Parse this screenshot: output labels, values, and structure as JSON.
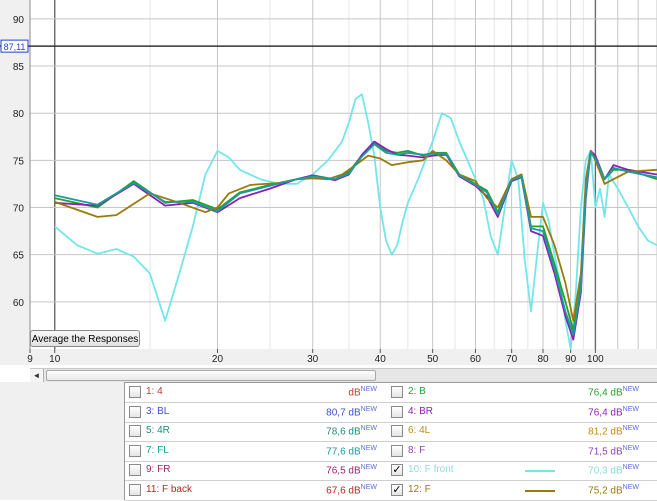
{
  "cursor_readout": "87,11",
  "average_button_label": "Average the Responses",
  "scroll_left_glyph": "◄",
  "chart_data": {
    "type": "line",
    "xlabel": "",
    "ylabel": "",
    "x_scale": "log",
    "xlim": [
      9,
      130
    ],
    "ylim": [
      55,
      92
    ],
    "x_ticks": [
      9,
      10,
      20,
      30,
      40,
      50,
      60,
      70,
      80,
      90,
      100
    ],
    "x_tick_labels": [
      "9",
      "10",
      "20",
      "30",
      "40",
      "50",
      "60",
      "70",
      "80",
      "90",
      "100"
    ],
    "y_ticks": [
      60,
      65,
      70,
      75,
      80,
      85,
      90
    ],
    "y_tick_labels": [
      "60",
      "65",
      "70",
      "75",
      "80",
      "85",
      "90"
    ],
    "cursor_y": 87.11,
    "grid": true,
    "series": [
      {
        "name": "10: F front",
        "color": "#72e6ea",
        "x": [
          10,
          11,
          12,
          13,
          14,
          15,
          16,
          17,
          18,
          19,
          20,
          21,
          22,
          24,
          26,
          28,
          30,
          32,
          34,
          35,
          36,
          37,
          38,
          39,
          40,
          41,
          42,
          43,
          44,
          45,
          47,
          50,
          52,
          54,
          56,
          58,
          60,
          62,
          64,
          66,
          68,
          70,
          72,
          74,
          76,
          78,
          80,
          82,
          84,
          86,
          88,
          90,
          92,
          94,
          96,
          98,
          100,
          102,
          104,
          106,
          110,
          115,
          120,
          125,
          130
        ],
        "y": [
          68,
          66,
          65.1,
          65.6,
          64.8,
          63,
          58,
          63,
          68,
          73.5,
          76,
          75.3,
          74,
          73,
          72.5,
          72.5,
          73.5,
          75,
          77,
          79,
          81.5,
          82,
          79,
          75.5,
          70,
          66.5,
          65,
          66,
          68.5,
          70.5,
          73,
          77,
          80,
          79.5,
          77,
          75,
          73,
          71,
          67,
          65,
          70,
          75,
          73,
          64.5,
          59,
          65,
          70.5,
          68.5,
          65,
          62,
          58,
          55,
          61,
          70,
          75,
          76,
          70,
          72,
          69,
          73.5,
          72,
          70,
          68,
          66.5,
          66
        ]
      },
      {
        "name": "2: B",
        "color": "#22a22b",
        "x": [
          10,
          12,
          14,
          16,
          18,
          20,
          22,
          25,
          28,
          30,
          33,
          35,
          37,
          39,
          41,
          43,
          45,
          48,
          50,
          53,
          56,
          60,
          63,
          66,
          70,
          73,
          76,
          80,
          84,
          88,
          91,
          94,
          96,
          98,
          100,
          104,
          108,
          115,
          130
        ],
        "y": [
          71,
          70,
          72.8,
          70.5,
          70.8,
          69.8,
          71.6,
          72.4,
          73,
          73.4,
          73,
          73.8,
          75.5,
          76.8,
          76,
          75.8,
          76,
          75.5,
          75.8,
          75.8,
          73.5,
          72.5,
          71.8,
          69.5,
          73,
          73.5,
          68,
          68,
          64,
          60,
          57,
          62,
          72,
          76,
          75,
          73,
          74,
          74,
          73
        ]
      },
      {
        "name": "4: BR",
        "color": "#8b1fb8",
        "x": [
          10,
          12,
          14,
          16,
          18,
          20,
          22,
          25,
          28,
          30,
          33,
          35,
          37,
          39,
          41,
          43,
          45,
          48,
          50,
          53,
          56,
          60,
          63,
          66,
          70,
          73,
          76,
          80,
          84,
          88,
          91,
          94,
          96,
          98,
          100,
          104,
          108,
          115,
          130
        ],
        "y": [
          70.5,
          70.2,
          72.5,
          70.2,
          70.5,
          69.5,
          71,
          72,
          73,
          73.4,
          72.9,
          73.5,
          75.6,
          77,
          76.2,
          75.6,
          75.5,
          75.3,
          75.5,
          75.6,
          73.3,
          72.3,
          71.2,
          69,
          72.8,
          73.2,
          67.5,
          67,
          63,
          58.5,
          56,
          61,
          71,
          76,
          75.5,
          73,
          74.5,
          74,
          73.5
        ]
      },
      {
        "name": "12: F",
        "color": "#9a7a0a",
        "x": [
          10,
          12,
          13,
          15,
          17,
          19,
          20,
          21,
          23,
          26,
          28,
          30,
          32,
          34,
          36,
          38,
          40,
          42,
          45,
          48,
          50,
          53,
          56,
          60,
          63,
          66,
          70,
          73,
          76,
          80,
          84,
          88,
          91,
          94,
          96,
          98,
          100,
          104,
          108,
          115,
          130
        ],
        "y": [
          70.6,
          69,
          69.2,
          71.5,
          70.5,
          69.5,
          70,
          71.5,
          72.4,
          72.6,
          73,
          73.1,
          73,
          73.5,
          74.5,
          75.5,
          75.2,
          74.5,
          74.8,
          75,
          76,
          75,
          73.5,
          72.8,
          71,
          70,
          73,
          73.5,
          69,
          69,
          66,
          62,
          58,
          63,
          73,
          76,
          75,
          72.5,
          73,
          73.8,
          74
        ]
      },
      {
        "name": "7: FL",
        "color": "#1a9c9c",
        "x": [
          10,
          12,
          14,
          16,
          18,
          20,
          22,
          25,
          28,
          30,
          33,
          35,
          37,
          39,
          41,
          43,
          45,
          48,
          50,
          53,
          56,
          60,
          63,
          66,
          70,
          73,
          76,
          80,
          84,
          88,
          91,
          94,
          96,
          98,
          100,
          104,
          108,
          115,
          130
        ],
        "y": [
          71.3,
          70.3,
          72.6,
          70.6,
          70.6,
          69.6,
          71.5,
          72.3,
          73,
          73.3,
          73,
          73.6,
          75.4,
          76.7,
          75.8,
          75.6,
          75.8,
          75.6,
          75.7,
          75.7,
          73.4,
          72.4,
          71.6,
          69.3,
          72.9,
          73.3,
          67.8,
          67.5,
          63.5,
          59,
          56.5,
          61.5,
          71.5,
          75.8,
          75.2,
          73,
          74.2,
          73.8,
          73.2
        ]
      }
    ]
  },
  "legend": {
    "rows": [
      {
        "left": {
          "label": "1: 4",
          "value": "dB",
          "new": "NEW",
          "checked": false,
          "color": "#c0392b",
          "show_swatch": false
        },
        "right": {
          "label": "2: B",
          "value": "76,4 dB",
          "new": "NEW",
          "checked": false,
          "color": "#22a22b",
          "show_swatch": false
        }
      },
      {
        "left": {
          "label": "3: BL",
          "value": "80,7 dB",
          "new": "NEW",
          "checked": false,
          "color": "#3a4fcf",
          "show_swatch": false
        },
        "right": {
          "label": "4: BR",
          "value": "76,4 dB",
          "new": "NEW",
          "checked": false,
          "color": "#8b1fb8",
          "show_swatch": false
        }
      },
      {
        "left": {
          "label": "5: 4R",
          "value": "78,6 dB",
          "new": "NEW",
          "checked": false,
          "color": "#1f8a7a",
          "show_swatch": false
        },
        "right": {
          "label": "6: 4L",
          "value": "81,2 dB",
          "new": "NEW",
          "checked": false,
          "color": "#c08a12",
          "show_swatch": false
        }
      },
      {
        "left": {
          "label": "7: FL",
          "value": "77,6 dB",
          "new": "NEW",
          "checked": false,
          "color": "#1a9c9c",
          "show_swatch": false
        },
        "right": {
          "label": "8: F",
          "value": "71,5 dB",
          "new": "NEW",
          "checked": false,
          "color": "#8e44ad",
          "show_swatch": false
        }
      },
      {
        "left": {
          "label": "9: FR",
          "value": "76,5 dB",
          "new": "NEW",
          "checked": false,
          "color": "#a4206a",
          "show_swatch": false
        },
        "right": {
          "label": "10: F front",
          "value": "70,3 dB",
          "new": "NEW",
          "checked": true,
          "color": "#72e6ea",
          "show_swatch": true
        }
      },
      {
        "left": {
          "label": "11: F back",
          "value": "67,6 dB",
          "new": "NEW",
          "checked": false,
          "color": "#b3261e",
          "show_swatch": false
        },
        "right": {
          "label": "12: F",
          "value": "75,2 dB",
          "new": "NEW",
          "checked": true,
          "color": "#9a7a0a",
          "show_swatch": true
        }
      }
    ]
  }
}
